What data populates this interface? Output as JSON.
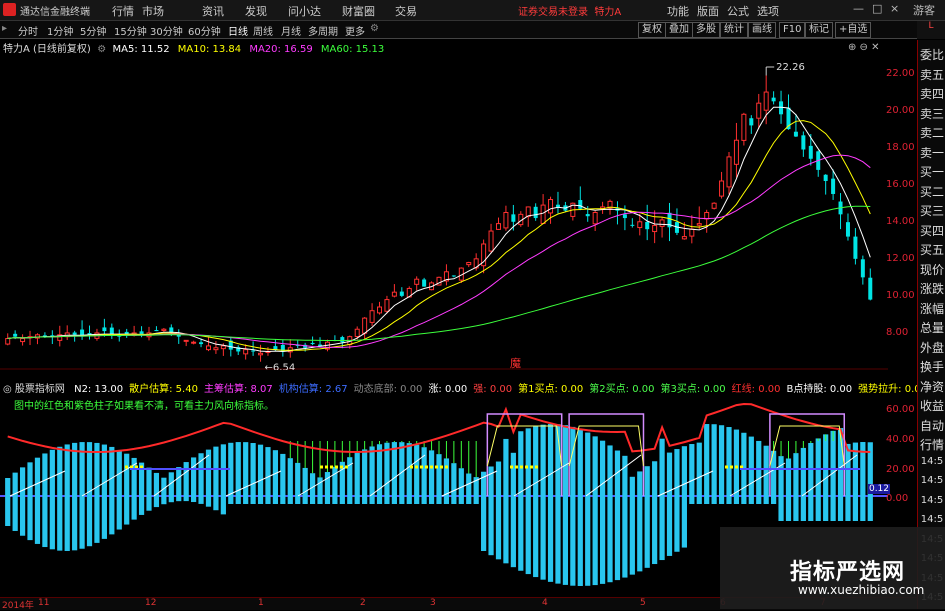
{
  "app": {
    "title": "通达信金融终端",
    "notice": "证券交易未登录",
    "stock_name": "特力A"
  },
  "menu": [
    "行情",
    "市场",
    "资讯",
    "发现",
    "问小达",
    "财富圈",
    "交易"
  ],
  "right_menu": [
    "功能",
    "版面",
    "公式",
    "选项"
  ],
  "window_buttons": {
    "restore": "□",
    "close": "×",
    "guest": "游客"
  },
  "toolbar": {
    "periods": [
      "分时",
      "1分钟",
      "5分钟",
      "15分钟",
      "30分钟",
      "60分钟",
      "日线",
      "周线",
      "月线",
      "多周期",
      "更多"
    ],
    "active": "日线",
    "right": [
      "复权",
      "叠加",
      "多股",
      "统计",
      "画线",
      "F10",
      "标记",
      "+自选"
    ]
  },
  "info": {
    "name": "特力A",
    "mode": "(日线前复权)",
    "ma5": "MA5: 11.52",
    "ma10": "MA10: 13.84",
    "ma20": "MA20: 16.59",
    "ma60": "MA60: 15.13"
  },
  "y_axis": [
    "22.00",
    "20.00",
    "18.00",
    "16.00",
    "14.00",
    "12.00",
    "10.00",
    "8.00"
  ],
  "price_labels": {
    "high": "22.26",
    "low": "6.54"
  },
  "marker": "魔",
  "indicator": {
    "name": "股票指标网",
    "items": [
      {
        "text": "N2: 13.00",
        "color": "#ffffff"
      },
      {
        "text": "散户估算: 5.40",
        "color": "#ffff00"
      },
      {
        "text": "主筹估算: 8.07",
        "color": "#ff3cff"
      },
      {
        "text": "机构估算: 2.67",
        "color": "#3c6cff"
      },
      {
        "text": "动态底部: 0.00",
        "color": "#888888"
      },
      {
        "text": "涨: 0.00",
        "color": "#ffffff"
      },
      {
        "text": "强: 0.00",
        "color": "#ff4040"
      },
      {
        "text": "第1买点: 0.00",
        "color": "#ffff00"
      },
      {
        "text": "第2买点: 0.00",
        "color": "#4cff4c"
      },
      {
        "text": "第3买点: 0.00",
        "color": "#4cff4c"
      },
      {
        "text": "红线: 0.00",
        "color": "#ff3030"
      },
      {
        "text": "B点持股: 0.00",
        "color": "#ffffff"
      },
      {
        "text": "强势拉升: 0.00",
        "color": "#ffff00"
      }
    ],
    "note": "图中的红色和紫色柱子如果看不清，可看主力风向标指标。",
    "y_axis": [
      "60.00",
      "40.00",
      "20.00",
      "0.00"
    ],
    "last_value": "0.12"
  },
  "right_panel": {
    "tag": "L",
    "items": [
      "委比",
      "卖五",
      "卖四",
      "卖三",
      "卖二",
      "卖一",
      "买一",
      "买二",
      "买三",
      "买四",
      "买五",
      "现价",
      "涨跌",
      "涨幅",
      "总量",
      "外盘",
      "换手",
      "净资",
      "收益",
      "自动",
      "行情",
      "14:5",
      "14:5",
      "14:5",
      "14:5",
      "14:5",
      "14:5",
      "14:5",
      "14:5"
    ]
  },
  "dates": [
    "2014年",
    "11",
    "12",
    "1",
    "2",
    "3",
    "4",
    "5",
    "6",
    "7"
  ],
  "watermark": {
    "title": "指标严选网",
    "url": "www.xuezhibiao.com"
  },
  "colors": {
    "up": "#ff3030",
    "down": "#00e5e5",
    "ma5": "#ffffff",
    "ma10": "#ffff00",
    "ma20": "#ff3cff",
    "ma60": "#3cff3c"
  },
  "chart_data": {
    "type": "candlestick",
    "y_range": [
      6.0,
      23.0
    ],
    "closes": [
      7.7,
      7.8,
      7.7,
      7.8,
      7.9,
      7.8,
      7.8,
      7.9,
      8.0,
      7.9,
      7.8,
      7.9,
      8.0,
      8.1,
      7.9,
      7.8,
      7.9,
      8.0,
      7.9,
      8.0,
      8.1,
      8.2,
      8.0,
      7.8,
      7.6,
      7.5,
      7.4,
      7.3,
      7.2,
      7.3,
      7.1,
      7.0,
      7.1,
      7.0,
      6.9,
      7.0,
      7.1,
      7.0,
      7.2,
      7.3,
      7.2,
      7.4,
      7.3,
      7.5,
      7.6,
      7.5,
      7.8,
      8.2,
      8.8,
      9.2,
      9.4,
      9.8,
      10.2,
      10.0,
      10.4,
      10.9,
      10.5,
      10.7,
      11.0,
      11.3,
      11.1,
      11.5,
      11.8,
      12.0,
      12.8,
      13.5,
      13.9,
      14.5,
      14.0,
      14.4,
      14.8,
      14.2,
      14.9,
      15.2,
      14.8,
      14.6,
      15.0,
      14.7,
      14.3,
      14.5,
      14.8,
      15.1,
      14.6,
      14.2,
      13.8,
      14.0,
      13.6,
      13.8,
      14.1,
      13.7,
      13.4,
      13.2,
      13.6,
      13.9,
      14.5,
      15.0,
      16.2,
      17.5,
      18.4,
      19.8,
      19.2,
      20.4,
      21.0,
      20.5,
      19.8,
      19.0,
      18.6,
      17.9,
      17.4,
      16.8,
      16.2,
      15.5,
      14.4,
      13.2,
      12.0,
      11.0,
      9.8
    ],
    "ma5_last": 11.52,
    "ma10_last": 13.84,
    "ma20_last": 16.59,
    "ma60_last": 15.13
  }
}
